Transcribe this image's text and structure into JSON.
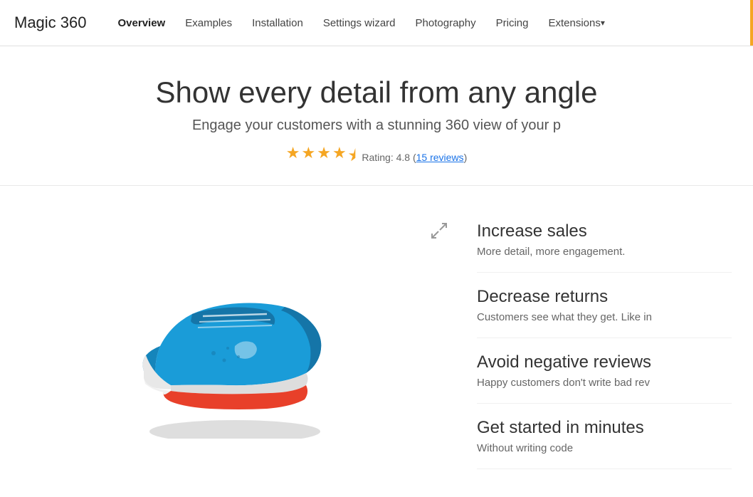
{
  "header": {
    "logo": "Magic 360",
    "nav": [
      {
        "label": "Overview",
        "active": true,
        "hasArrow": false
      },
      {
        "label": "Examples",
        "active": false,
        "hasArrow": false
      },
      {
        "label": "Installation",
        "active": false,
        "hasArrow": false
      },
      {
        "label": "Settings wizard",
        "active": false,
        "hasArrow": false
      },
      {
        "label": "Photography",
        "active": false,
        "hasArrow": false
      },
      {
        "label": "Pricing",
        "active": false,
        "hasArrow": false
      },
      {
        "label": "Extensions",
        "active": false,
        "hasArrow": true
      }
    ]
  },
  "hero": {
    "title": "Show every detail from any angle",
    "subtitle": "Engage your customers with a stunning 360 view of your p",
    "rating": {
      "value": "4.8",
      "label": "Rating: 4.8",
      "reviews_label": "15 reviews",
      "reviews_count": 15
    }
  },
  "expand_icon": "⤢",
  "features": [
    {
      "title": "Increase sales",
      "desc": "More detail, more engagement."
    },
    {
      "title": "Decrease returns",
      "desc": "Customers see what they get. Like in"
    },
    {
      "title": "Avoid negative reviews",
      "desc": "Happy customers don't write bad rev"
    },
    {
      "title": "Get started in minutes",
      "desc": "Without writing code"
    }
  ],
  "stars": {
    "full": 4,
    "half": 1,
    "empty": 0
  }
}
